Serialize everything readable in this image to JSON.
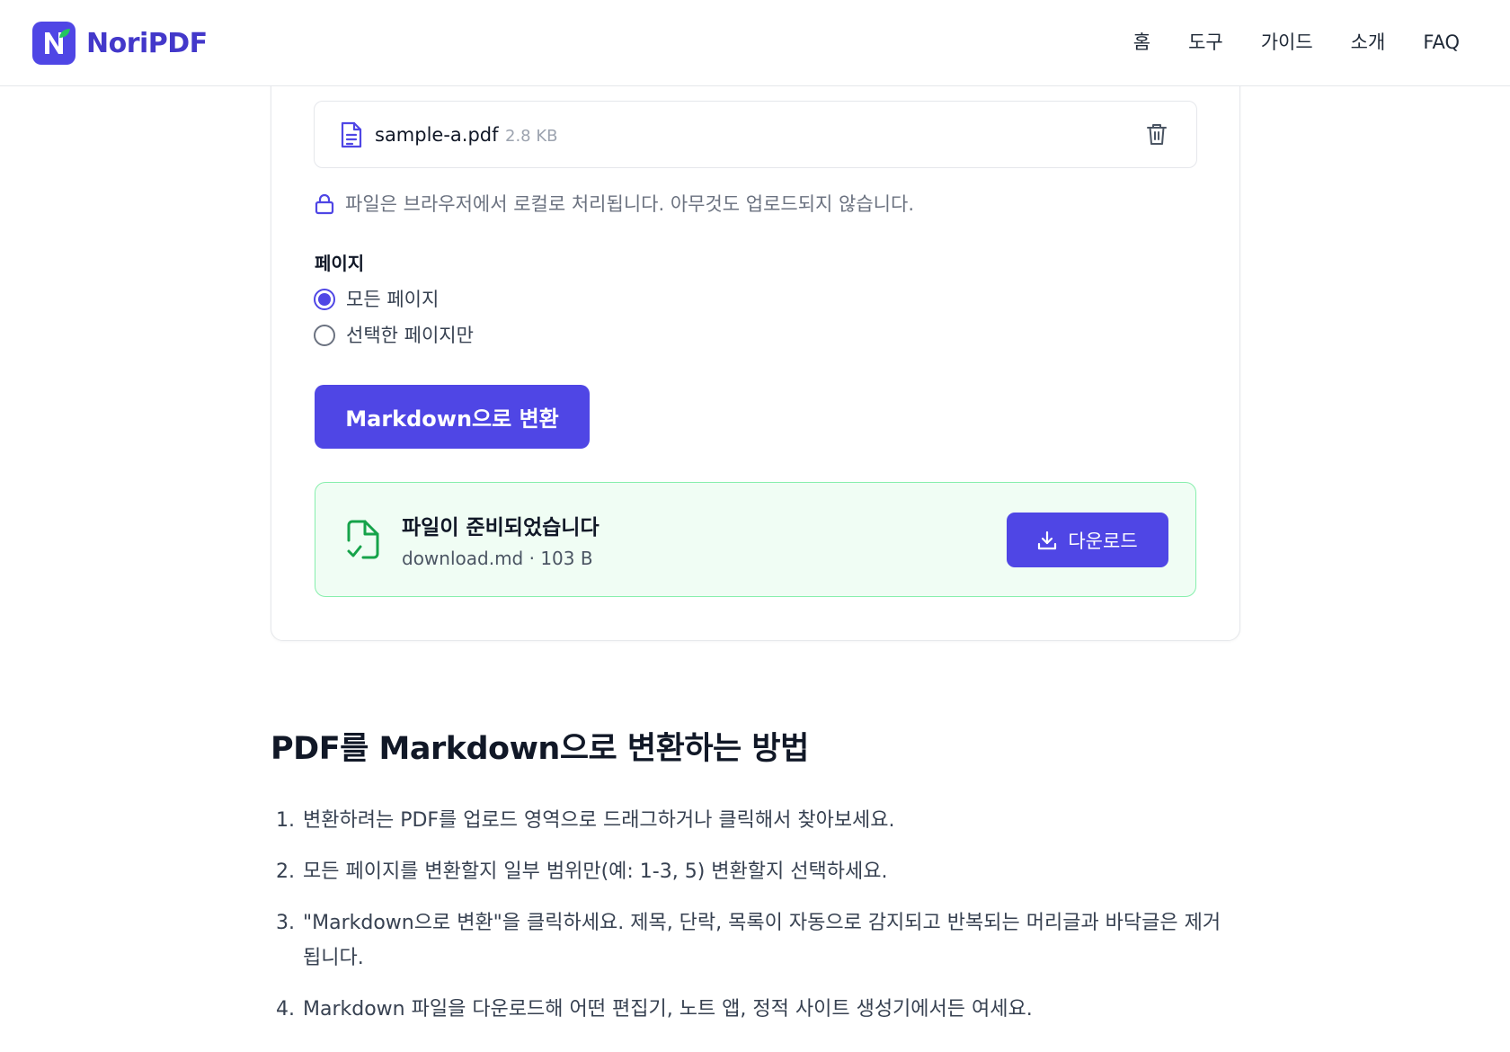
{
  "header": {
    "brand": "NoriPDF",
    "nav": [
      "홈",
      "도구",
      "가이드",
      "소개",
      "FAQ"
    ]
  },
  "file": {
    "name": "sample-a.pdf",
    "size": "2.8 KB"
  },
  "privacy_note": "파일은 브라우저에서 로컬로 처리됩니다. 아무것도 업로드되지 않습니다.",
  "pages": {
    "label": "페이지",
    "options": [
      "모든 페이지",
      "선택한 페이지만"
    ],
    "selected": "모든 페이지"
  },
  "convert_button": "Markdown으로 변환",
  "result": {
    "title": "파일이 준비되었습니다",
    "meta": "download.md · 103 B",
    "download_label": "다운로드"
  },
  "guide": {
    "title": "PDF를 Markdown으로 변환하는 방법",
    "steps": [
      {
        "num": "1.",
        "text": "변환하려는 PDF를 업로드 영역으로 드래그하거나 클릭해서 찾아보세요."
      },
      {
        "num": "2.",
        "text": "모든 페이지를 변환할지 일부 범위만(예: 1-3, 5) 변환할지 선택하세요."
      },
      {
        "num": "3.",
        "text": "\"Markdown으로 변환\"을 클릭하세요. 제목, 단락, 목록이 자동으로 감지되고 반복되는 머리글과 바닥글은 제거됩니다."
      },
      {
        "num": "4.",
        "text": "Markdown 파일을 다운로드해 어떤 편집기, 노트 앱, 정적 사이트 생성기에서든 여세요."
      }
    ]
  },
  "colors": {
    "accent": "#4f46e5",
    "success_bg": "#f0fdf4",
    "success_border": "#86efac",
    "success_icon": "#16a34a"
  }
}
